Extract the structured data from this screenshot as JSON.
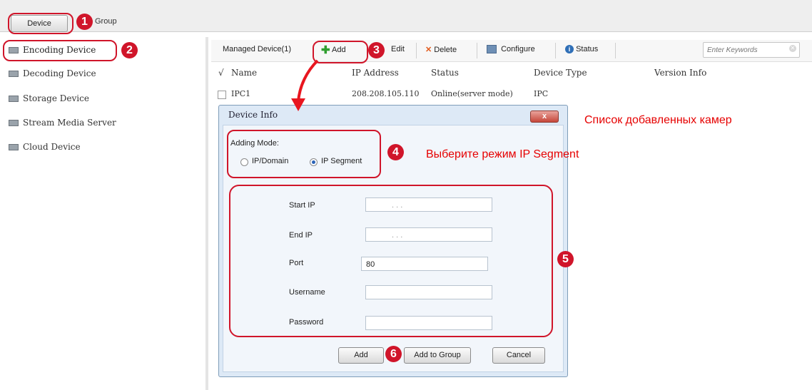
{
  "top_tabs": {
    "device": "Device",
    "group": "Group"
  },
  "sidebar": {
    "items": [
      {
        "label": "Encoding Device"
      },
      {
        "label": "Decoding Device"
      },
      {
        "label": "Storage Device"
      },
      {
        "label": "Stream Media Server"
      },
      {
        "label": "Cloud Device"
      }
    ]
  },
  "toolbar": {
    "managed": "Managed Device(1)",
    "add": "Add",
    "edit": "Edit",
    "delete": "Delete",
    "configure": "Configure",
    "status": "Status",
    "search_placeholder": "Enter Keywords"
  },
  "table": {
    "check_header": "√",
    "columns": [
      "Name",
      "IP Address",
      "Status",
      "Device Type",
      "Version Info"
    ],
    "rows": [
      {
        "name": "IPC1",
        "ip": "208.208.105.110",
        "status": "Online(server mode)",
        "type": "IPC",
        "version": ""
      }
    ]
  },
  "dialog": {
    "title": "Device Info",
    "close": "x",
    "adding_mode_label": "Adding Mode:",
    "mode_ip_domain": "IP/Domain",
    "mode_ip_segment": "IP Segment",
    "selected_mode": "IP Segment",
    "start_ip_label": "Start IP",
    "end_ip_label": "End IP",
    "port_label": "Port",
    "port_value": "80",
    "username_label": "Username",
    "password_label": "Password",
    "ip_placeholder": ".        .        .",
    "add_button": "Add",
    "add_to_group_button": "Add to Group",
    "cancel_button": "Cancel"
  },
  "annotations": {
    "n1": "1",
    "n2": "2",
    "n3": "3",
    "n4": "4",
    "n5": "5",
    "n6": "6",
    "list_note": "Список добавленных камер",
    "mode_note": "Выберите режим IP Segment",
    "color": "#d0152a"
  }
}
